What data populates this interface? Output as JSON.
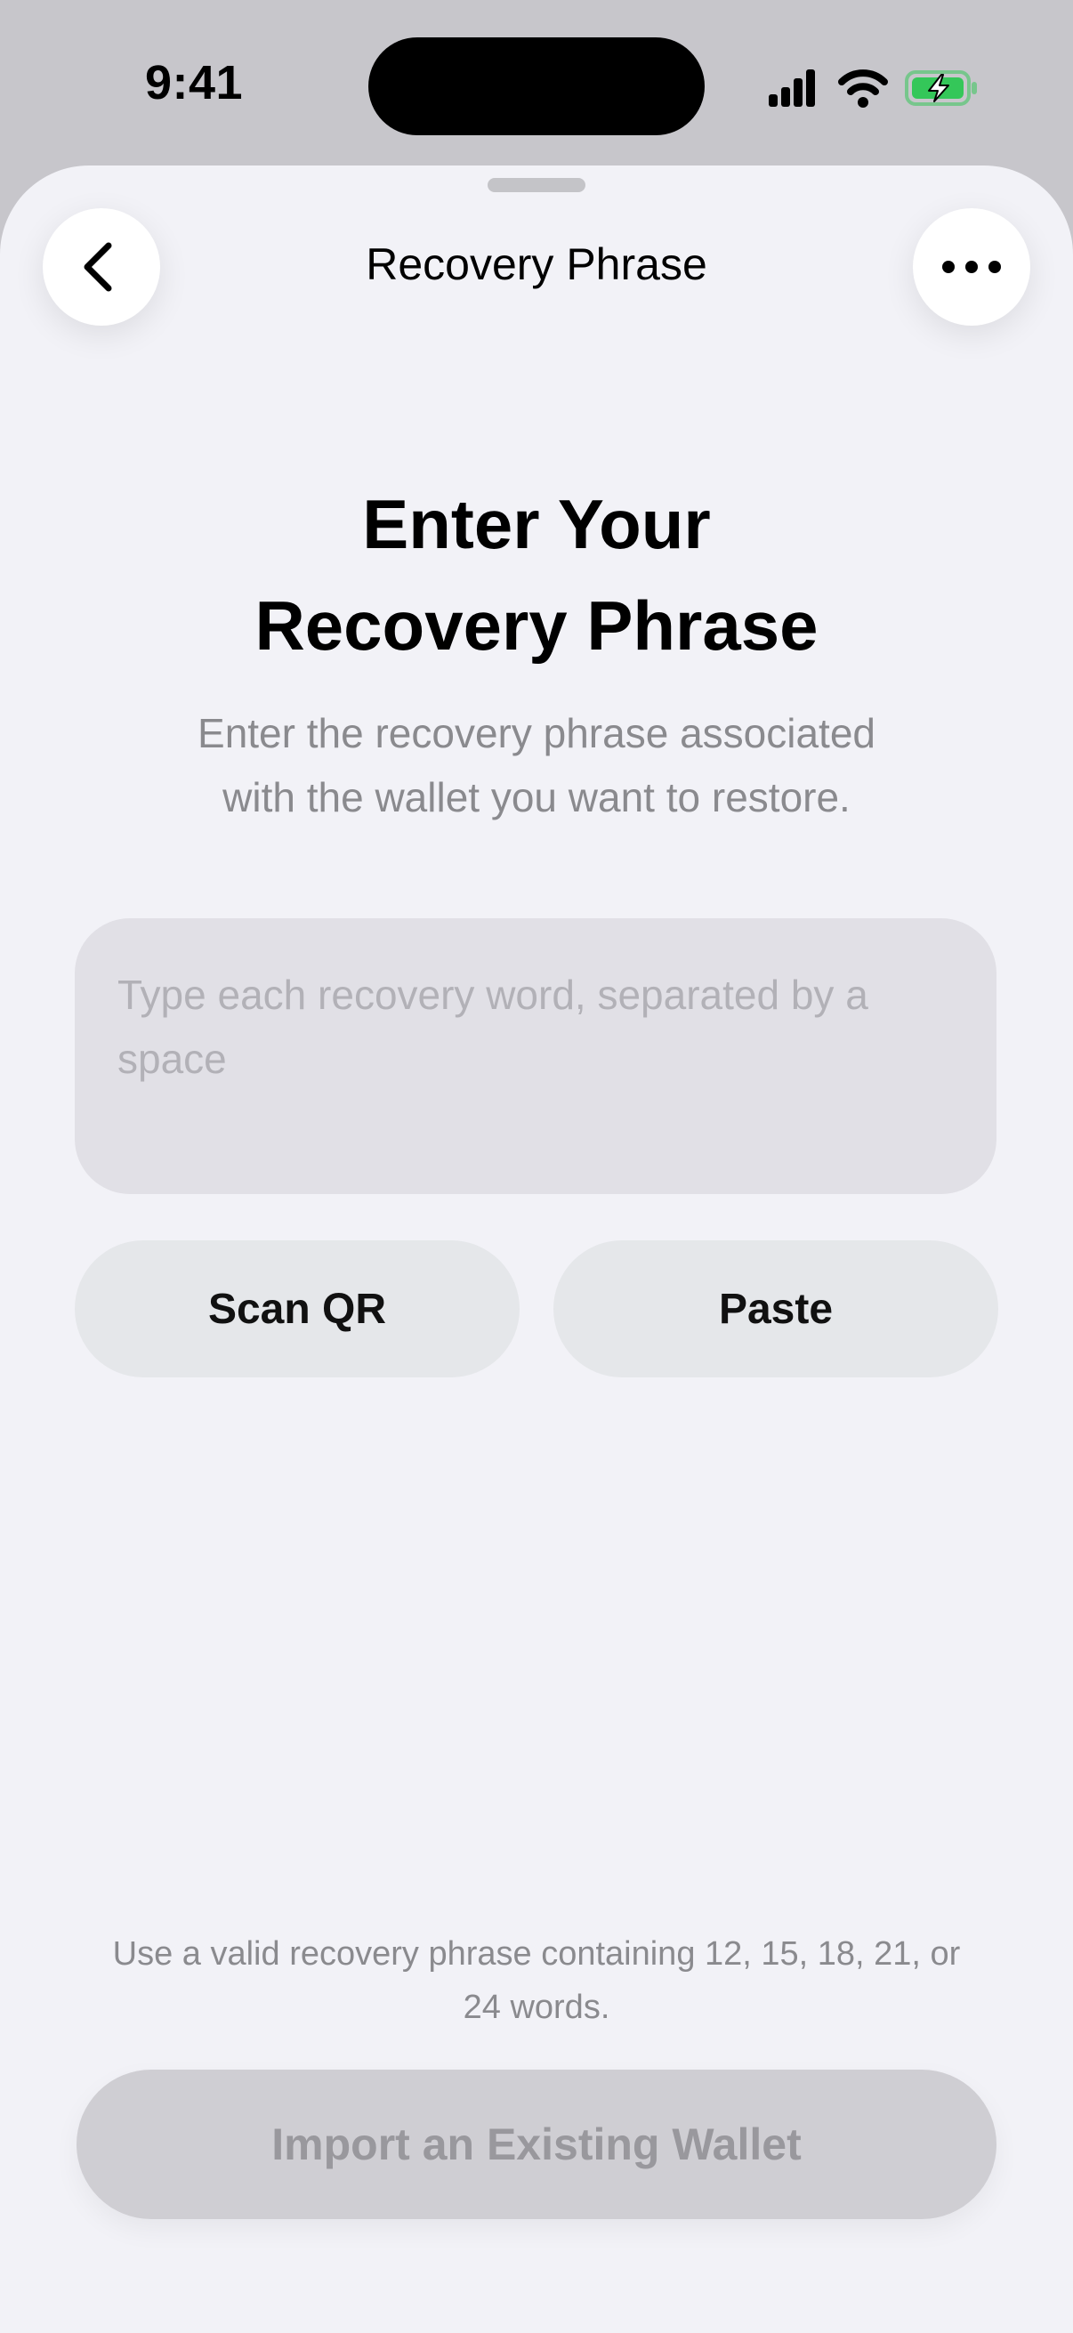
{
  "status_bar": {
    "time": "9:41",
    "icons": [
      "cellular-signal-icon",
      "wifi-icon",
      "battery-charging-icon"
    ],
    "battery_color": "#34c759"
  },
  "nav": {
    "title": "Recovery Phrase",
    "back_icon": "chevron-left-icon",
    "more_icon": "ellipsis-icon"
  },
  "main": {
    "headline_line1": "Enter Your",
    "headline_line2": "Recovery Phrase",
    "subtitle_line1": "Enter the recovery phrase associated",
    "subtitle_line2": "with the wallet you want to restore.",
    "phrase_input": {
      "value": "",
      "placeholder": "Type each recovery word, separated by a space"
    },
    "scan_qr_label": "Scan QR",
    "paste_label": "Paste"
  },
  "footer": {
    "hint_line1": "Use a valid recovery phrase containing 12, 15, 18, 21, or",
    "hint_line2": "24 words.",
    "import_label": "Import an Existing Wallet",
    "import_enabled": false
  },
  "colors": {
    "sheet_background": "#f2f2f7",
    "backdrop": "#c7c6cb",
    "input_background": "#e1e0e6",
    "secondary_button_background": "#e5e7ea",
    "disabled_button_background": "#cfced3",
    "secondary_text": "#8a8a8e"
  }
}
